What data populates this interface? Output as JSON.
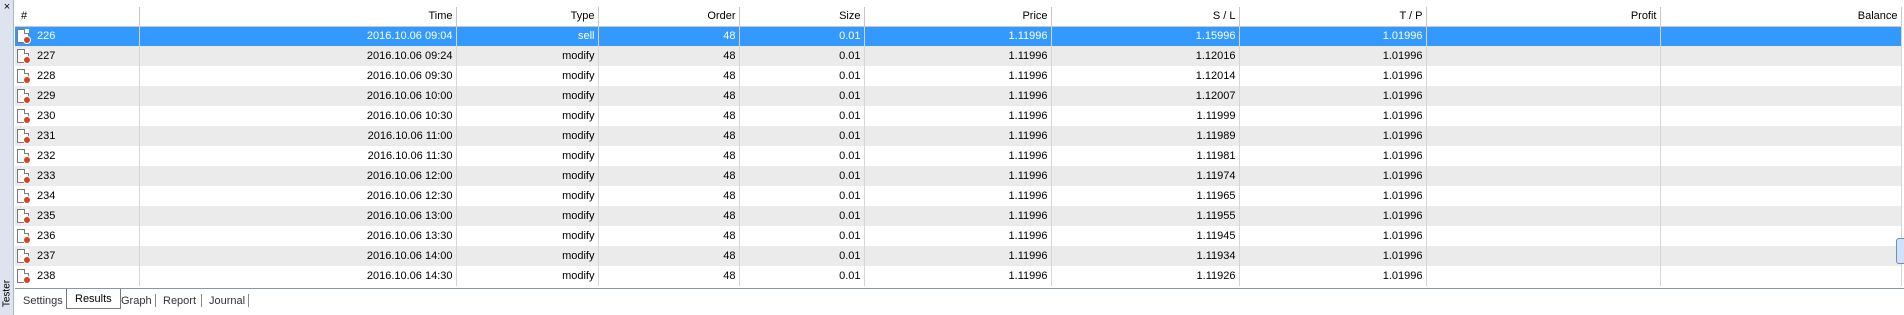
{
  "window": {
    "panel_label": "Tester",
    "close_glyph": "×"
  },
  "columns": [
    "#",
    "Time",
    "Type",
    "Order",
    "Size",
    "Price",
    "S / L",
    "T / P",
    "Profit",
    "Balance"
  ],
  "rows": [
    {
      "num": "226",
      "time": "2016.10.06 09:04",
      "type": "sell",
      "order": "48",
      "size": "0.01",
      "price": "1.11996",
      "sl": "1.15996",
      "tp": "1.01996",
      "profit": "",
      "balance": "",
      "selected": true
    },
    {
      "num": "227",
      "time": "2016.10.06 09:24",
      "type": "modify",
      "order": "48",
      "size": "0.01",
      "price": "1.11996",
      "sl": "1.12016",
      "tp": "1.01996",
      "profit": "",
      "balance": ""
    },
    {
      "num": "228",
      "time": "2016.10.06 09:30",
      "type": "modify",
      "order": "48",
      "size": "0.01",
      "price": "1.11996",
      "sl": "1.12014",
      "tp": "1.01996",
      "profit": "",
      "balance": ""
    },
    {
      "num": "229",
      "time": "2016.10.06 10:00",
      "type": "modify",
      "order": "48",
      "size": "0.01",
      "price": "1.11996",
      "sl": "1.12007",
      "tp": "1.01996",
      "profit": "",
      "balance": ""
    },
    {
      "num": "230",
      "time": "2016.10.06 10:30",
      "type": "modify",
      "order": "48",
      "size": "0.01",
      "price": "1.11996",
      "sl": "1.11999",
      "tp": "1.01996",
      "profit": "",
      "balance": ""
    },
    {
      "num": "231",
      "time": "2016.10.06 11:00",
      "type": "modify",
      "order": "48",
      "size": "0.01",
      "price": "1.11996",
      "sl": "1.11989",
      "tp": "1.01996",
      "profit": "",
      "balance": ""
    },
    {
      "num": "232",
      "time": "2016.10.06 11:30",
      "type": "modify",
      "order": "48",
      "size": "0.01",
      "price": "1.11996",
      "sl": "1.11981",
      "tp": "1.01996",
      "profit": "",
      "balance": ""
    },
    {
      "num": "233",
      "time": "2016.10.06 12:00",
      "type": "modify",
      "order": "48",
      "size": "0.01",
      "price": "1.11996",
      "sl": "1.11974",
      "tp": "1.01996",
      "profit": "",
      "balance": ""
    },
    {
      "num": "234",
      "time": "2016.10.06 12:30",
      "type": "modify",
      "order": "48",
      "size": "0.01",
      "price": "1.11996",
      "sl": "1.11965",
      "tp": "1.01996",
      "profit": "",
      "balance": ""
    },
    {
      "num": "235",
      "time": "2016.10.06 13:00",
      "type": "modify",
      "order": "48",
      "size": "0.01",
      "price": "1.11996",
      "sl": "1.11955",
      "tp": "1.01996",
      "profit": "",
      "balance": ""
    },
    {
      "num": "236",
      "time": "2016.10.06 13:30",
      "type": "modify",
      "order": "48",
      "size": "0.01",
      "price": "1.11996",
      "sl": "1.11945",
      "tp": "1.01996",
      "profit": "",
      "balance": ""
    },
    {
      "num": "237",
      "time": "2016.10.06 14:00",
      "type": "modify",
      "order": "48",
      "size": "0.01",
      "price": "1.11996",
      "sl": "1.11934",
      "tp": "1.01996",
      "profit": "",
      "balance": ""
    },
    {
      "num": "238",
      "time": "2016.10.06 14:30",
      "type": "modify",
      "order": "48",
      "size": "0.01",
      "price": "1.11996",
      "sl": "1.11926",
      "tp": "1.01996",
      "profit": "",
      "balance": ""
    }
  ],
  "row_icon": "order-modify-icon",
  "tabs": [
    {
      "label": "Settings",
      "active": false
    },
    {
      "label": "Results",
      "active": true
    },
    {
      "label": "Graph",
      "active": false
    },
    {
      "label": "Report",
      "active": false
    },
    {
      "label": "Journal",
      "active": false
    }
  ],
  "colors": {
    "selection": "#3399ff",
    "alt_row": "#ebebeb",
    "icon_badge": "#d9401e"
  }
}
